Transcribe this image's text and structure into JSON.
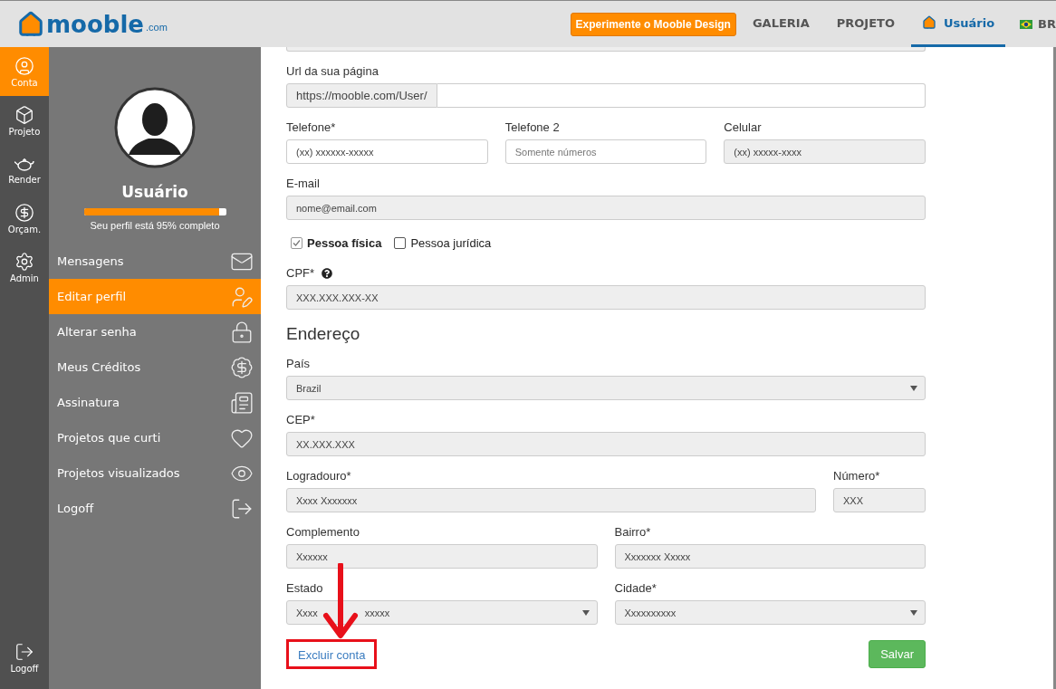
{
  "header": {
    "logo": {
      "name": "mooble",
      "suffix": ".com"
    },
    "cta": "Experimente o Mooble Design",
    "nav": [
      {
        "label": "GALERIA",
        "selected": false,
        "kind": "text"
      },
      {
        "label": "PROJETO",
        "selected": false,
        "kind": "text"
      },
      {
        "label": "Usuário",
        "selected": true,
        "kind": "home"
      }
    ],
    "language": "BR"
  },
  "rail": {
    "items": [
      {
        "label": "Conta",
        "selected": true,
        "kind": "user"
      },
      {
        "label": "Projeto",
        "selected": false,
        "kind": "cube"
      },
      {
        "label": "Render",
        "selected": false,
        "kind": "teapot"
      },
      {
        "label": "Orçam.",
        "selected": false,
        "kind": "dollar"
      },
      {
        "label": "Admin",
        "selected": false,
        "kind": "gear"
      }
    ],
    "logoff": "Logoff"
  },
  "profile": {
    "name": "Usuário",
    "level": 0.95,
    "progress_text": "Seu perfil está 95% completo"
  },
  "menu": [
    {
      "label": "Mensagens",
      "selected": false,
      "kind": "mail"
    },
    {
      "label": "Editar perfil",
      "selected": true,
      "kind": "user-edit"
    },
    {
      "label": "Alterar senha",
      "selected": false,
      "kind": "lock"
    },
    {
      "label": "Meus Créditos",
      "selected": false,
      "kind": "money"
    },
    {
      "label": "Assinatura",
      "selected": false,
      "kind": "doc"
    },
    {
      "label": "Projetos que curti",
      "selected": false,
      "kind": "heart"
    },
    {
      "label": "Projetos visualizados",
      "selected": false,
      "kind": "eye"
    },
    {
      "label": "Logoff",
      "selected": false,
      "kind": "logout"
    }
  ],
  "form": {
    "url": {
      "label": "Url da sua página",
      "prefix": "https://mooble.com/User/"
    },
    "phones": [
      {
        "label": "Telefone*",
        "value": "(xx) xxxxxx-xxxxx",
        "disabled": false
      },
      {
        "label": "Telefone 2",
        "placeholder": "Somente números",
        "disabled": false
      },
      {
        "label": "Celular",
        "value": "(xx) xxxxx-xxxx",
        "disabled": true
      }
    ],
    "email": {
      "label": "E-mail",
      "value": "nome@email.com",
      "disabled": true
    },
    "person_types": [
      {
        "label": "Pessoa física",
        "checked": true
      },
      {
        "label": "Pessoa jurídica",
        "checked": false
      }
    ],
    "cpf": {
      "label": "CPF*",
      "value": "XXX.XXX.XXX-XX",
      "disabled": true
    },
    "address_heading": "Endereço",
    "country": {
      "label": "País",
      "value": "Brazil",
      "disabled": true
    },
    "cep": {
      "label": "CEP*",
      "value": "XX.XXX.XXX",
      "disabled": true
    },
    "street": {
      "label": "Logradouro*",
      "value": "Xxxx Xxxxxxx",
      "disabled": true
    },
    "number": {
      "label": "Número*",
      "value": "XXX",
      "disabled": true
    },
    "complement": {
      "label": "Complemento",
      "value": "Xxxxxx",
      "disabled": true
    },
    "district": {
      "label": "Bairro*",
      "value": "Xxxxxxx Xxxxx",
      "disabled": true
    },
    "state": {
      "label": "Estado",
      "value_parts": [
        "Xxxx",
        "xxxxx"
      ],
      "disabled": true
    },
    "city": {
      "label": "Cidade*",
      "value": "Xxxxxxxxxx",
      "disabled": true
    },
    "delete_link": "Excluir conta",
    "save": "Salvar"
  }
}
